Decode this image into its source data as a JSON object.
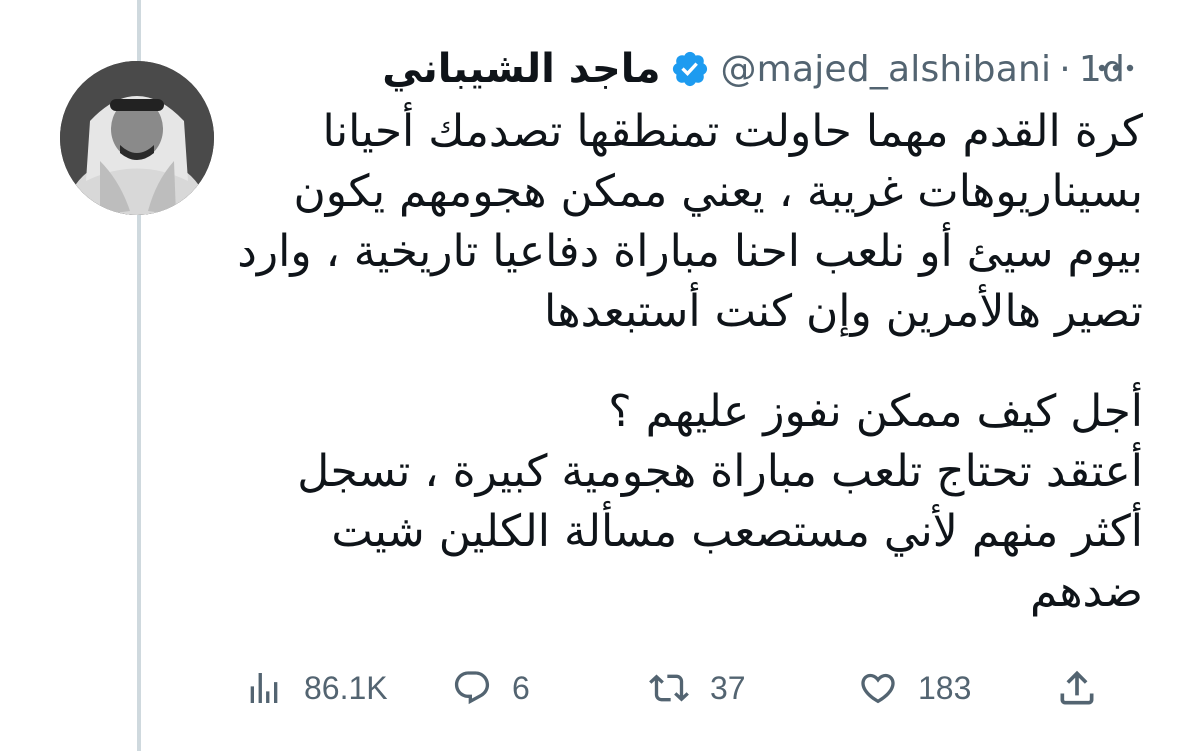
{
  "tweet": {
    "display_name": "ماجد الشيباني",
    "handle": "@majed_alshibani",
    "separator": "·",
    "time": "1d",
    "paragraphs": [
      [
        "كرة القدم مهما حاولت تمنطقها تصدمك أحيانا",
        "بسيناريوهات غريبة ، يعني ممكن هجومهم يكون",
        "بيوم سيئ أو نلعب احنا مباراة دفاعيا تاريخية ، وارد",
        "تصير هالأمرين وإن كنت أستبعدها"
      ],
      [
        "أجل كيف ممكن نفوز عليهم ؟",
        "أعتقد تحتاج تلعب مباراة هجومية كبيرة ، تسجل",
        "أكثر منهم لأني مستصعب مسألة الكلين شيت",
        "ضدهم"
      ]
    ]
  },
  "actions": {
    "views": "86.1K",
    "replies": "6",
    "retweets": "37",
    "likes": "183"
  },
  "colors": {
    "text": "#0f1419",
    "secondary": "#536471",
    "verified": "#1d9bf0",
    "thread_line": "#cfd9de"
  },
  "icons": [
    "more-icon",
    "verified-badge-icon",
    "views-icon",
    "reply-icon",
    "retweet-icon",
    "like-icon",
    "share-icon"
  ]
}
